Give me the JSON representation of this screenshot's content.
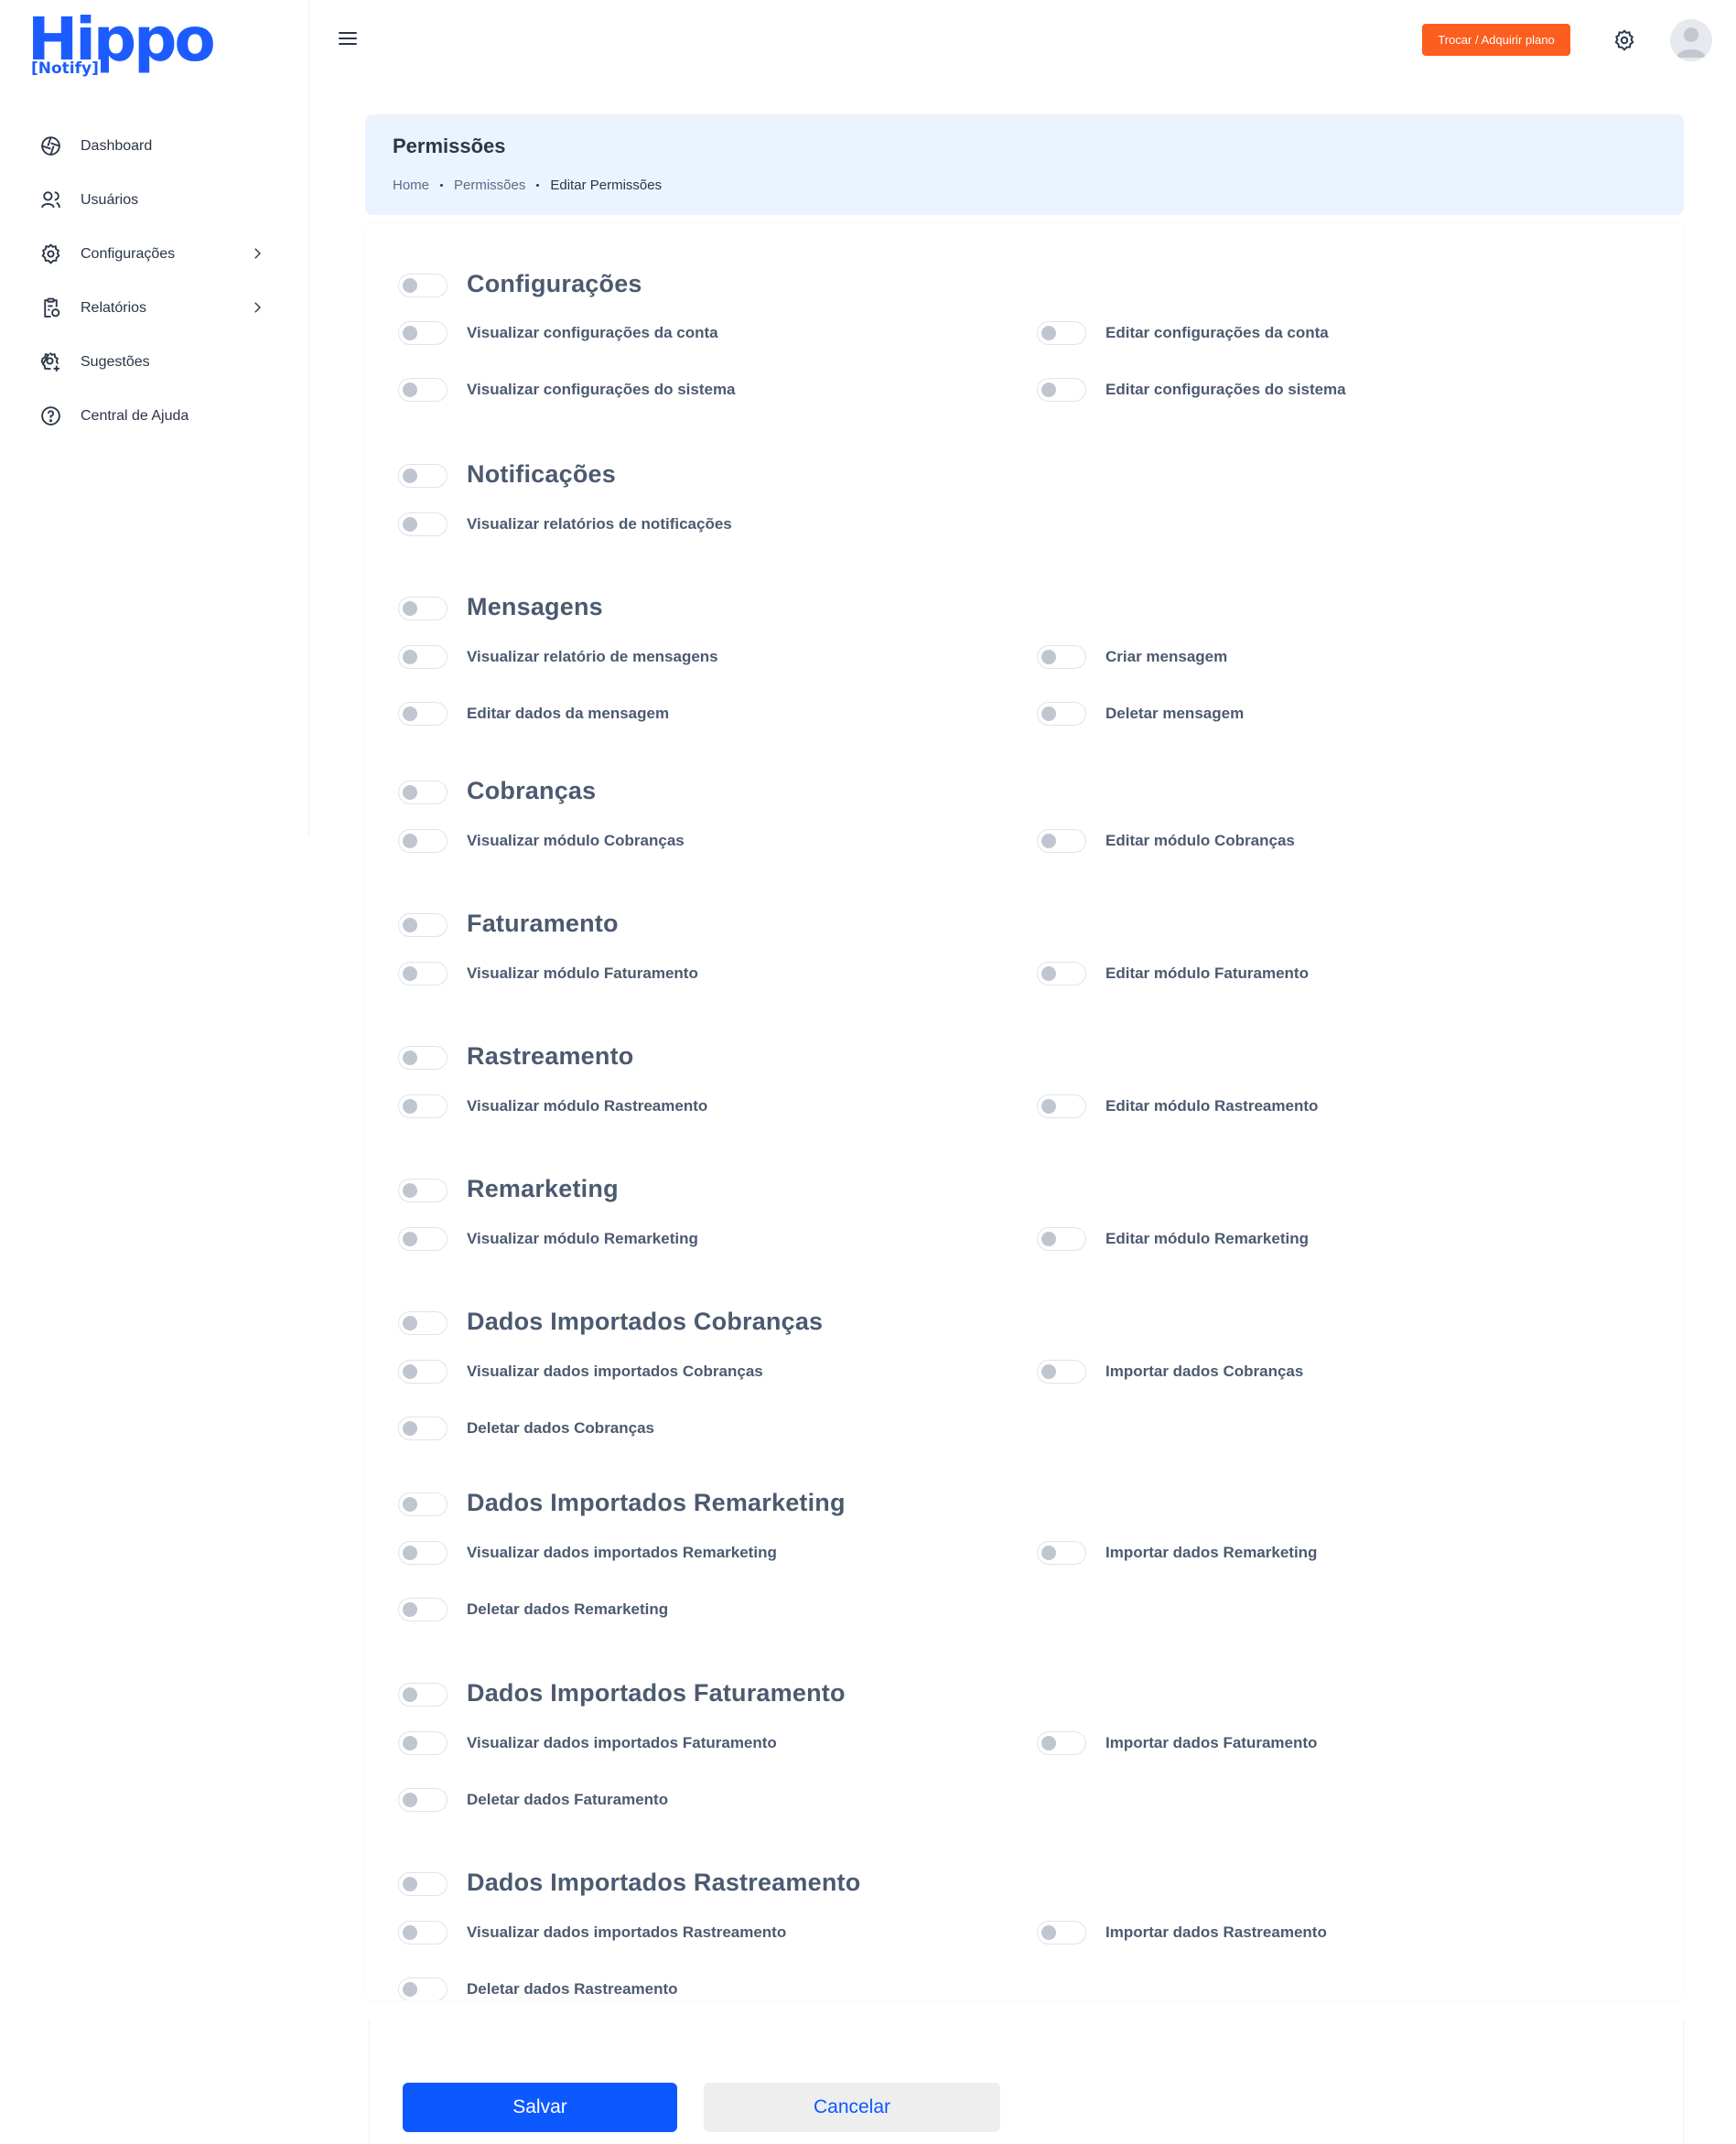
{
  "brand": {
    "name": "Hippo",
    "sub": "[Notify]",
    "color": "#1c5cff"
  },
  "sidebar": {
    "items": [
      {
        "label": "Dashboard",
        "icon": "aperture-icon"
      },
      {
        "label": "Usuários",
        "icon": "users-icon"
      },
      {
        "label": "Configurações",
        "icon": "gear-icon",
        "has_submenu": true
      },
      {
        "label": "Relatórios",
        "icon": "clipboard-report-icon",
        "has_submenu": true
      },
      {
        "label": "Sugestões",
        "icon": "gear-plus-icon"
      },
      {
        "label": "Central de Ajuda",
        "icon": "help-circle-icon"
      }
    ]
  },
  "header": {
    "plan_button": "Trocar / Adquirir plano",
    "plan_button_color": "#fd5d1e"
  },
  "page": {
    "title": "Permissões",
    "breadcrumb": [
      "Home",
      "Permissões",
      "Editar Permissões"
    ]
  },
  "sections": [
    {
      "title": "Configurações",
      "perms": [
        "Visualizar configurações da conta",
        "Editar configurações da conta",
        "Visualizar configurações do sistema",
        "Editar configurações do sistema"
      ]
    },
    {
      "title": "Notificações",
      "perms": [
        "Visualizar relatórios de notificações"
      ]
    },
    {
      "title": "Mensagens",
      "perms": [
        "Visualizar relatório de mensagens",
        "Criar mensagem",
        "Editar dados da mensagem",
        "Deletar mensagem"
      ]
    },
    {
      "title": "Cobranças",
      "perms": [
        "Visualizar módulo Cobranças",
        "Editar módulo Cobranças"
      ]
    },
    {
      "title": "Faturamento",
      "perms": [
        "Visualizar módulo Faturamento",
        "Editar módulo Faturamento"
      ]
    },
    {
      "title": "Rastreamento",
      "perms": [
        "Visualizar módulo Rastreamento",
        "Editar módulo Rastreamento"
      ]
    },
    {
      "title": "Remarketing",
      "perms": [
        "Visualizar módulo Remarketing",
        "Editar módulo Remarketing"
      ]
    },
    {
      "title": "Dados Importados Cobranças",
      "perms": [
        "Visualizar dados importados Cobranças",
        "Importar dados Cobranças",
        "Deletar dados Cobranças"
      ]
    },
    {
      "title": "Dados Importados Remarketing",
      "perms": [
        "Visualizar dados importados Remarketing",
        "Importar dados Remarketing",
        "Deletar dados Remarketing"
      ]
    },
    {
      "title": "Dados Importados Faturamento",
      "perms": [
        "Visualizar dados importados Faturamento",
        "Importar dados Faturamento",
        "Deletar dados Faturamento"
      ]
    },
    {
      "title": "Dados Importados Rastreamento",
      "perms": [
        "Visualizar dados importados Rastreamento",
        "Importar dados Rastreamento",
        "Deletar dados Rastreamento"
      ]
    }
  ],
  "toggles_state": "off",
  "footer": {
    "save_label": "Salvar",
    "cancel_label": "Cancelar",
    "save_color": "#0d58ff"
  }
}
